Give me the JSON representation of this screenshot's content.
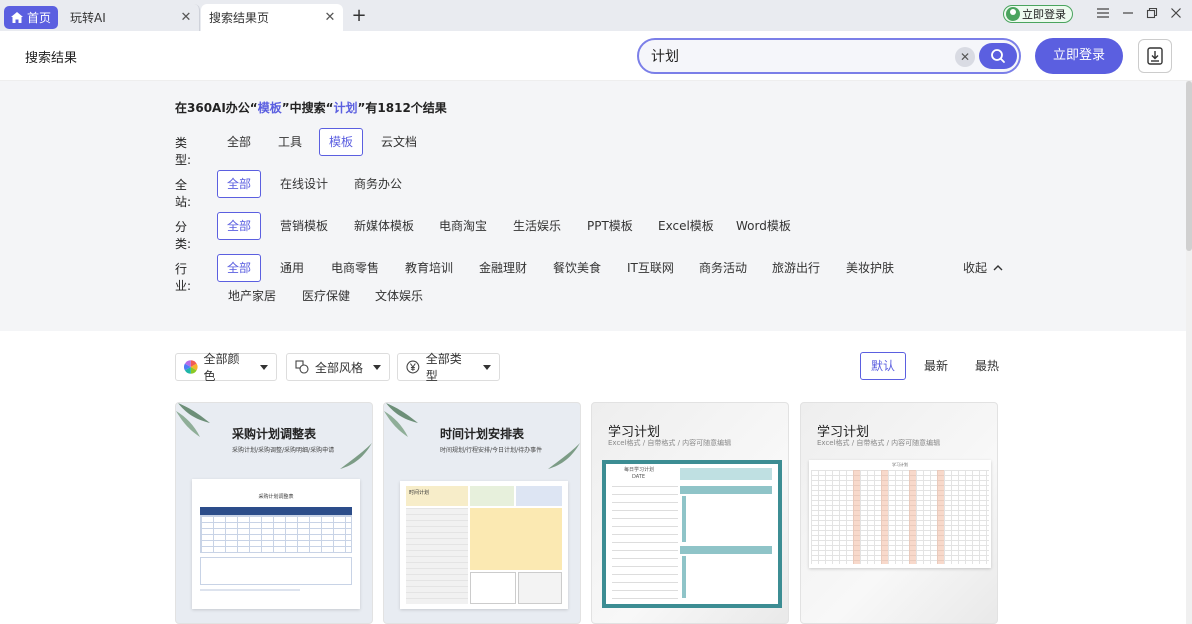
{
  "tabs": {
    "home": "首页",
    "tab1": "玩转AI",
    "tab2": "搜索结果页"
  },
  "topbar": {
    "login_small": "立即登录"
  },
  "header": {
    "title": "搜索结果",
    "search_value": "计划",
    "login": "立即登录"
  },
  "summary": {
    "p1": "在360AI办公“",
    "k1": "模板",
    "p2": "”中搜索“",
    "k2": "计划",
    "p3": "”有1812个结果"
  },
  "filters": {
    "type_label": "类型:",
    "type": [
      "全部",
      "工具",
      "模板",
      "云文档"
    ],
    "site_label": "全站:",
    "site": [
      "全部",
      "在线设计",
      "商务办公"
    ],
    "cat_label": "分类:",
    "cat": [
      "全部",
      "营销模板",
      "新媒体模板",
      "电商淘宝",
      "生活娱乐",
      "PPT模板",
      "Excel模板",
      "Word模板"
    ],
    "ind_label": "行业:",
    "ind": [
      "全部",
      "通用",
      "电商零售",
      "教育培训",
      "金融理财",
      "餐饮美食",
      "IT互联网",
      "商务活动",
      "旅游出行",
      "美妆护肤"
    ],
    "ind2": [
      "地产家居",
      "医疗保健",
      "文体娱乐"
    ],
    "collapse": "收起"
  },
  "sortbar": {
    "color": "全部颜色",
    "style": "全部风格",
    "kind": "全部类型",
    "sorts": [
      "默认",
      "最新",
      "最热"
    ]
  },
  "cards": [
    {
      "title": "采购计划调整表",
      "sub": "采购计划/采购调整/采购明细/采购申请",
      "inner": "采购计划调整表"
    },
    {
      "title": "时间计划安排表",
      "sub": "时间规划/行程安排/今日计划/待办事件",
      "inner": "时间计划"
    },
    {
      "title": "学习计划",
      "sub": "Excel格式 / 自带格式 / 内容可随意编辑",
      "inner": "每日学习计划",
      "inner2": "DATE"
    },
    {
      "title": "学习计划",
      "sub": "Excel格式 / 自带格式 / 内容可随意编辑",
      "inner": "学习计划"
    }
  ]
}
